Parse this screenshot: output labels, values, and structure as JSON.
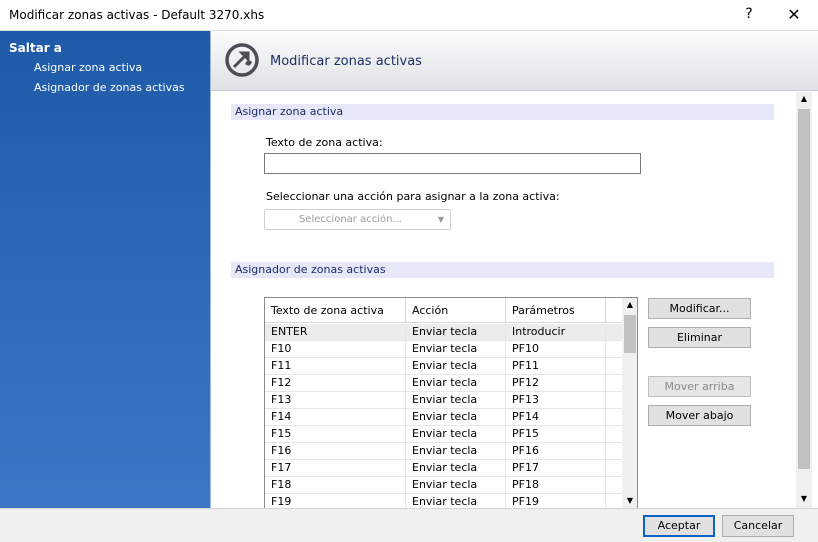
{
  "window": {
    "title": "Modificar zonas activas - Default 3270.xhs",
    "help_label": "?",
    "close_label": "✕"
  },
  "sidebar": {
    "heading": "Saltar a",
    "items": [
      {
        "label": "Asignar zona activa"
      },
      {
        "label": "Asignador de zonas activas"
      }
    ]
  },
  "header": {
    "title": "Modificar zonas activas"
  },
  "section_assign": {
    "title": "Asignar zona activa",
    "text_label": "Texto de zona activa:",
    "text_value": "",
    "action_label": "Seleccionar una acción para asignar a la zona activa:",
    "action_placeholder": "Seleccionar acción..."
  },
  "section_mapper": {
    "title": "Asignador de zonas activas",
    "columns": [
      "Texto de zona activa",
      "Acción",
      "Parámetros"
    ],
    "rows": [
      {
        "text": "ENTER",
        "action": "Enviar tecla",
        "params": "Introducir"
      },
      {
        "text": "F10",
        "action": "Enviar tecla",
        "params": "PF10"
      },
      {
        "text": "F11",
        "action": "Enviar tecla",
        "params": "PF11"
      },
      {
        "text": "F12",
        "action": "Enviar tecla",
        "params": "PF12"
      },
      {
        "text": "F13",
        "action": "Enviar tecla",
        "params": "PF13"
      },
      {
        "text": "F14",
        "action": "Enviar tecla",
        "params": "PF14"
      },
      {
        "text": "F15",
        "action": "Enviar tecla",
        "params": "PF15"
      },
      {
        "text": "F16",
        "action": "Enviar tecla",
        "params": "PF16"
      },
      {
        "text": "F17",
        "action": "Enviar tecla",
        "params": "PF17"
      },
      {
        "text": "F18",
        "action": "Enviar tecla",
        "params": "PF18"
      },
      {
        "text": "F19",
        "action": "Enviar tecla",
        "params": "PF19"
      }
    ],
    "buttons": {
      "modify": "Modificar...",
      "delete": "Eliminar",
      "move_up": "Mover arriba",
      "move_down": "Mover abajo"
    }
  },
  "footer": {
    "ok_label": "Aceptar",
    "cancel_label": "Cancelar"
  },
  "colors": {
    "sidebar_top": "#1e5aa8",
    "sidebar_bottom": "#3b79c6",
    "section_bar": "#e6e7f7",
    "accent": "#0a64c8"
  }
}
